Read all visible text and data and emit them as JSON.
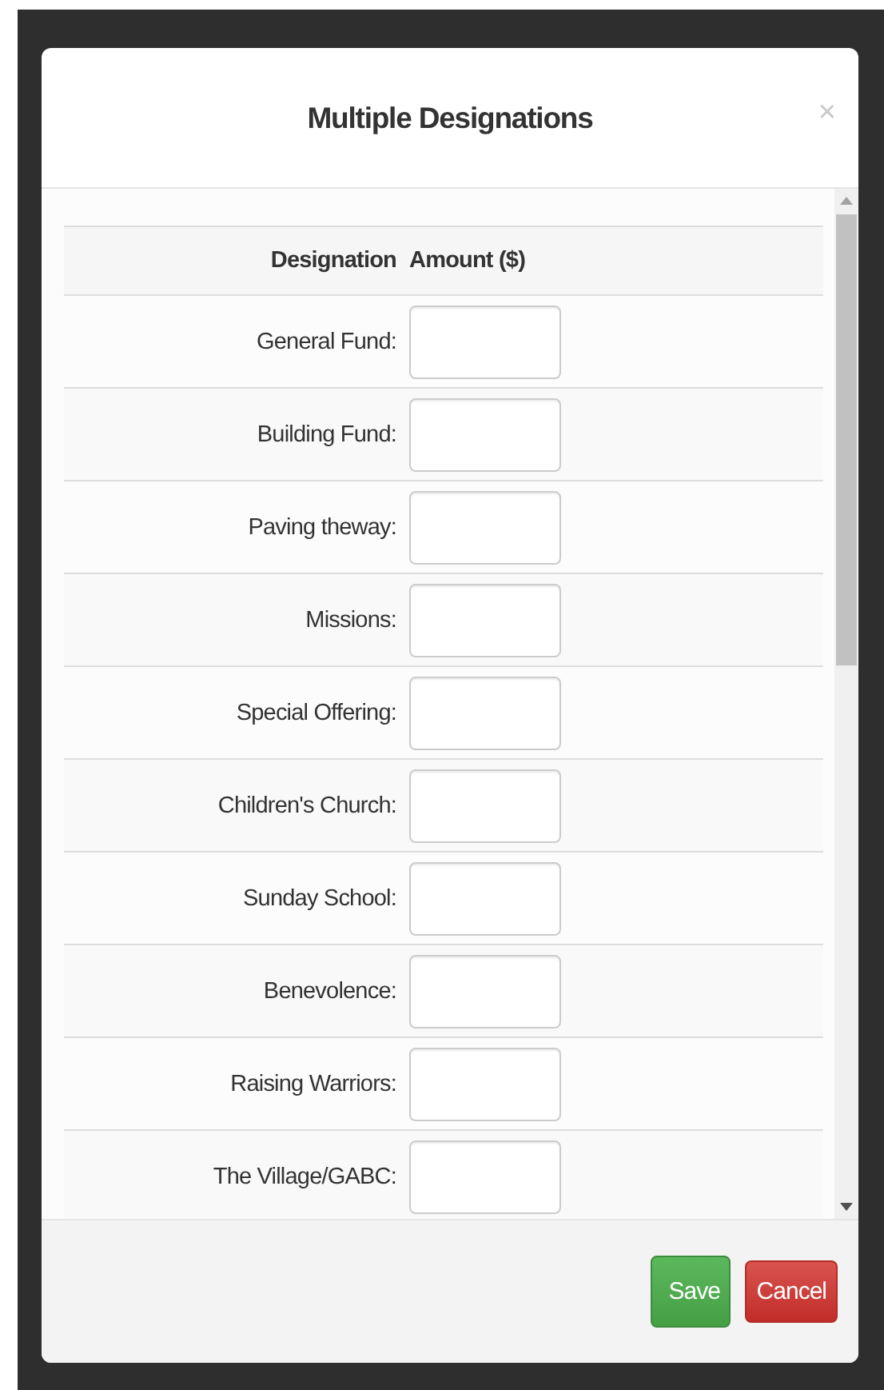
{
  "dialog": {
    "title": "Multiple Designations",
    "close": "×"
  },
  "table": {
    "columns": [
      "Designation",
      "Amount ($)"
    ],
    "rows": [
      {
        "designation": "General Fund:"
      },
      {
        "designation": "Building Fund:"
      },
      {
        "designation": "Paving theway:"
      },
      {
        "designation": "Missions:"
      },
      {
        "designation": "Special Offering:"
      },
      {
        "designation": "Children's Church:"
      },
      {
        "designation": "Sunday School:"
      },
      {
        "designation": "Benevolence:"
      },
      {
        "designation": "Raising Warriors:"
      },
      {
        "designation": "The Village/GABC:"
      }
    ]
  },
  "buttons": [
    {
      "label": "Save",
      "kind": "success"
    },
    {
      "label": "Cancel",
      "kind": "danger"
    }
  ]
}
